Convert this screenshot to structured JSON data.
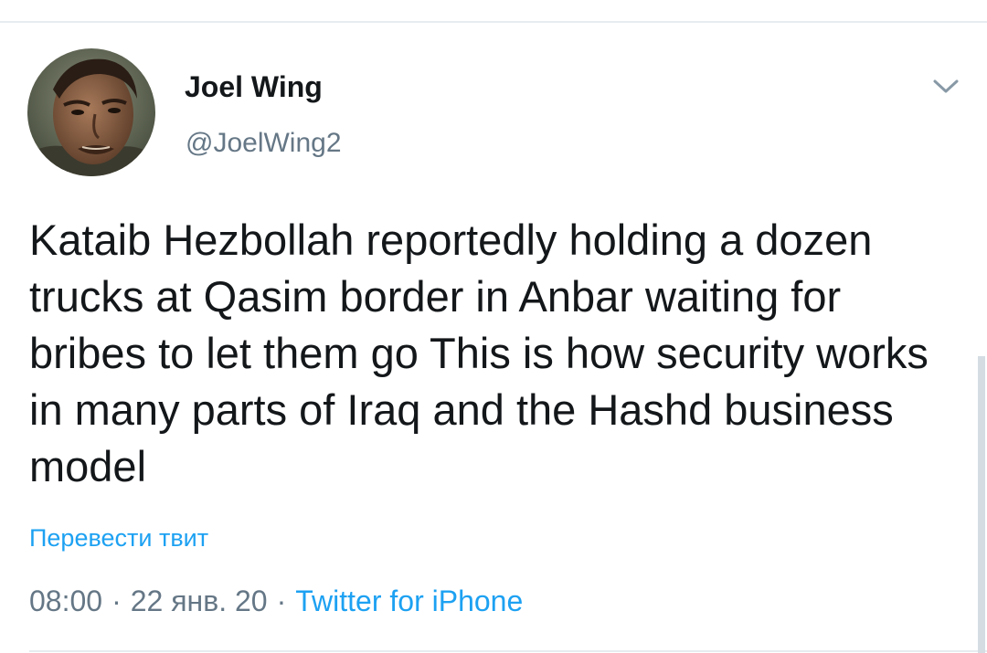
{
  "author": {
    "display_name": "Joel Wing",
    "handle": "@JoelWing2",
    "avatar_icon": "user-avatar-photo"
  },
  "tweet": {
    "text": "Kataib Hezbollah reportedly holding a dozen trucks at Qasim border in Anbar waiting for bribes to let them go This is how security works in many parts of Iraq and the Hashd business model",
    "translate_label": "Перевести твит",
    "time": "08:00",
    "separator": "·",
    "date": "22 янв. 20",
    "source": "Twitter for iPhone"
  },
  "icons": {
    "more": "chevron-down-icon"
  },
  "colors": {
    "text": "#14171a",
    "secondary": "#657786",
    "link": "#1da1f2",
    "divider": "#e6ecf0"
  }
}
